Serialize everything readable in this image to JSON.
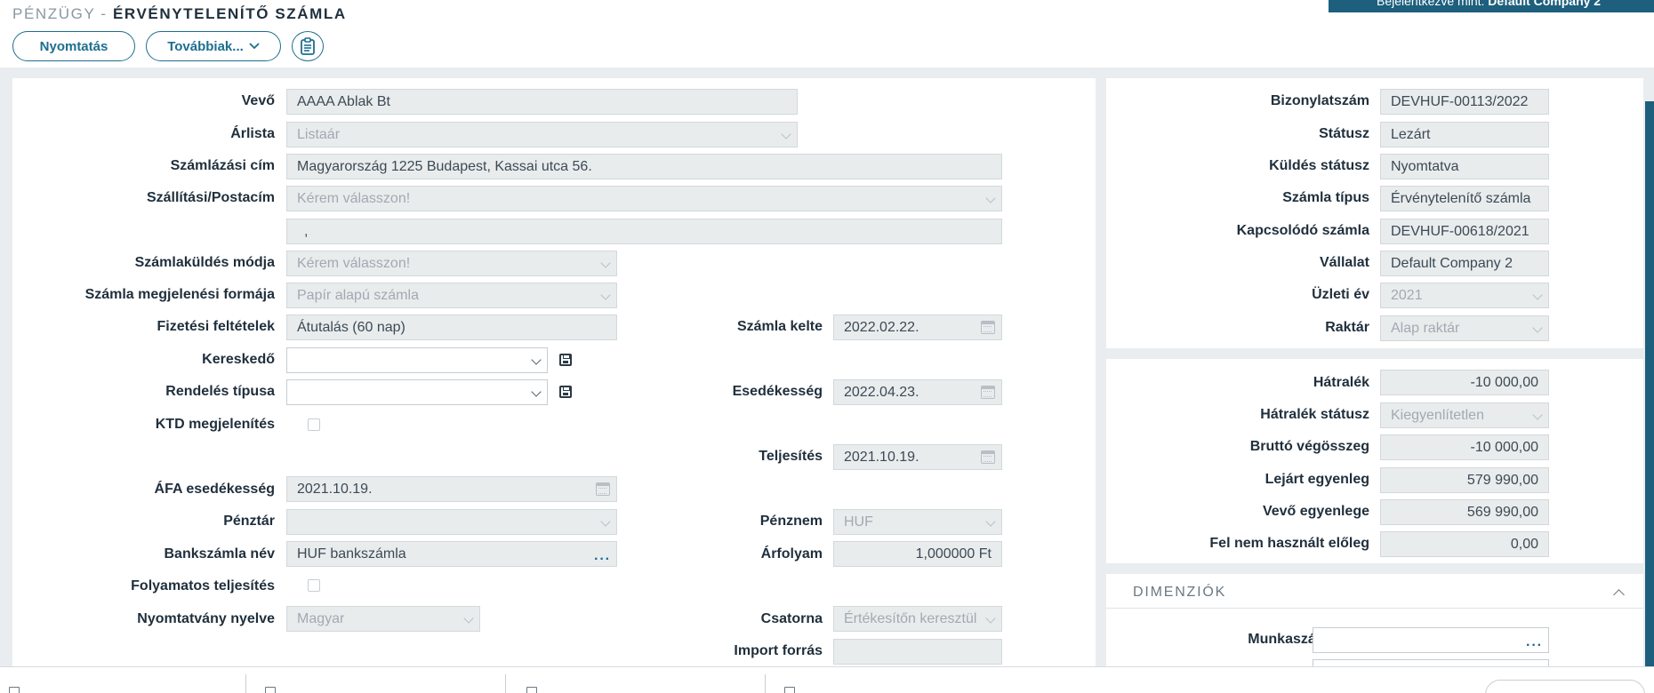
{
  "header": {
    "module": "PÉNZÜGY -",
    "page_title": "ÉRVÉNYTELENÍTŐ SZÁMLA",
    "user_prefix": "Bejelentkezve mint:",
    "user_company": "Default Company 2"
  },
  "toolbar": {
    "print_label": "Nyomtatás",
    "more_label": "Továbbiak..."
  },
  "form": {
    "vevo": {
      "label": "Vevő",
      "value": "AAAA Ablak Bt"
    },
    "arlista": {
      "label": "Árlista",
      "value": "Listaár"
    },
    "szamlazasi_cim": {
      "label": "Számlázási cím",
      "value": "Magyarország 1225 Budapest, Kassai utca 56."
    },
    "szallitasi_cim": {
      "label": "Szállítási/Postacím",
      "value": "Kérem válasszon!"
    },
    "cim_extra": {
      "value": ","
    },
    "kuldes_modja": {
      "label": "Számlaküldés módja",
      "value": "Kérem válasszon!"
    },
    "megjelenesi_forma": {
      "label": "Számla megjelenési formája",
      "value": "Papír alapú számla"
    },
    "fizetesi_feltetelek": {
      "label": "Fizetési feltételek",
      "value": "Átutalás (60 nap)"
    },
    "szamla_kelte": {
      "label": "Számla kelte",
      "value": "2022.02.22."
    },
    "kereskedo": {
      "label": "Kereskedő",
      "value": ""
    },
    "rendeles_tipusa": {
      "label": "Rendelés típusa",
      "value": ""
    },
    "esedekesseg": {
      "label": "Esedékesség",
      "value": "2022.04.23."
    },
    "ktd": {
      "label": "KTD megjelenítés"
    },
    "teljesites": {
      "label": "Teljesítés",
      "value": "2021.10.19."
    },
    "afa_esedekesseg": {
      "label": "ÁFA esedékesség",
      "value": "2021.10.19."
    },
    "penztar": {
      "label": "Pénztár",
      "value": ""
    },
    "penznem": {
      "label": "Pénznem",
      "value": "HUF"
    },
    "bankszamla": {
      "label": "Bankszámla név",
      "value": "HUF bankszámla"
    },
    "arfolyam": {
      "label": "Árfolyam",
      "value": "1,000000 Ft"
    },
    "folyamatos": {
      "label": "Folyamatos teljesítés"
    },
    "nyelv": {
      "label": "Nyomtatvány nyelve",
      "value": "Magyar"
    },
    "csatorna": {
      "label": "Csatorna",
      "value": "Értékesítőn keresztül"
    },
    "import_forras": {
      "label": "Import forrás",
      "value": ""
    }
  },
  "info": {
    "bizonylatszam": {
      "label": "Bizonylatszám",
      "value": "DEVHUF-00113/2022"
    },
    "statusz": {
      "label": "Státusz",
      "value": "Lezárt"
    },
    "kuldes_statusz": {
      "label": "Küldés státusz",
      "value": "Nyomtatva"
    },
    "szamla_tipus": {
      "label": "Számla típus",
      "value": "Érvénytelenítő számla"
    },
    "kapcsolodo": {
      "label": "Kapcsolódó számla",
      "value": "DEVHUF-00618/2021"
    },
    "vallalat": {
      "label": "Vállalat",
      "value": "Default Company 2"
    },
    "uzleti_ev": {
      "label": "Üzleti év",
      "value": "2021"
    },
    "raktar": {
      "label": "Raktár",
      "value": "Alap raktár"
    }
  },
  "balance": {
    "hatralek": {
      "label": "Hátralék",
      "value": "-10 000,00"
    },
    "hatralek_statusz": {
      "label": "Hátralék státusz",
      "value": "Kiegyenlítetlen"
    },
    "brutto": {
      "label": "Bruttó végösszeg",
      "value": "-10 000,00"
    },
    "lejart": {
      "label": "Lejárt egyenleg",
      "value": "579 990,00"
    },
    "vevo_egyenlege": {
      "label": "Vevő egyenlege",
      "value": "569 990,00"
    },
    "elo_leg": {
      "label": "Fel nem használt előleg",
      "value": "0,00"
    }
  },
  "dimensions": {
    "title": "DIMENZIÓK",
    "munkaszam": {
      "label": "Munkaszám",
      "value": ""
    }
  },
  "icons": {
    "print_list": "clipboard-list-icon",
    "calendar": "calendar-icon",
    "save": "floppy-disk-icon",
    "more": "ellipsis-icon"
  },
  "colors": {
    "accent": "#1d6e8f",
    "userbar": "#1d5f7d",
    "field_bg": "#e9eced"
  }
}
